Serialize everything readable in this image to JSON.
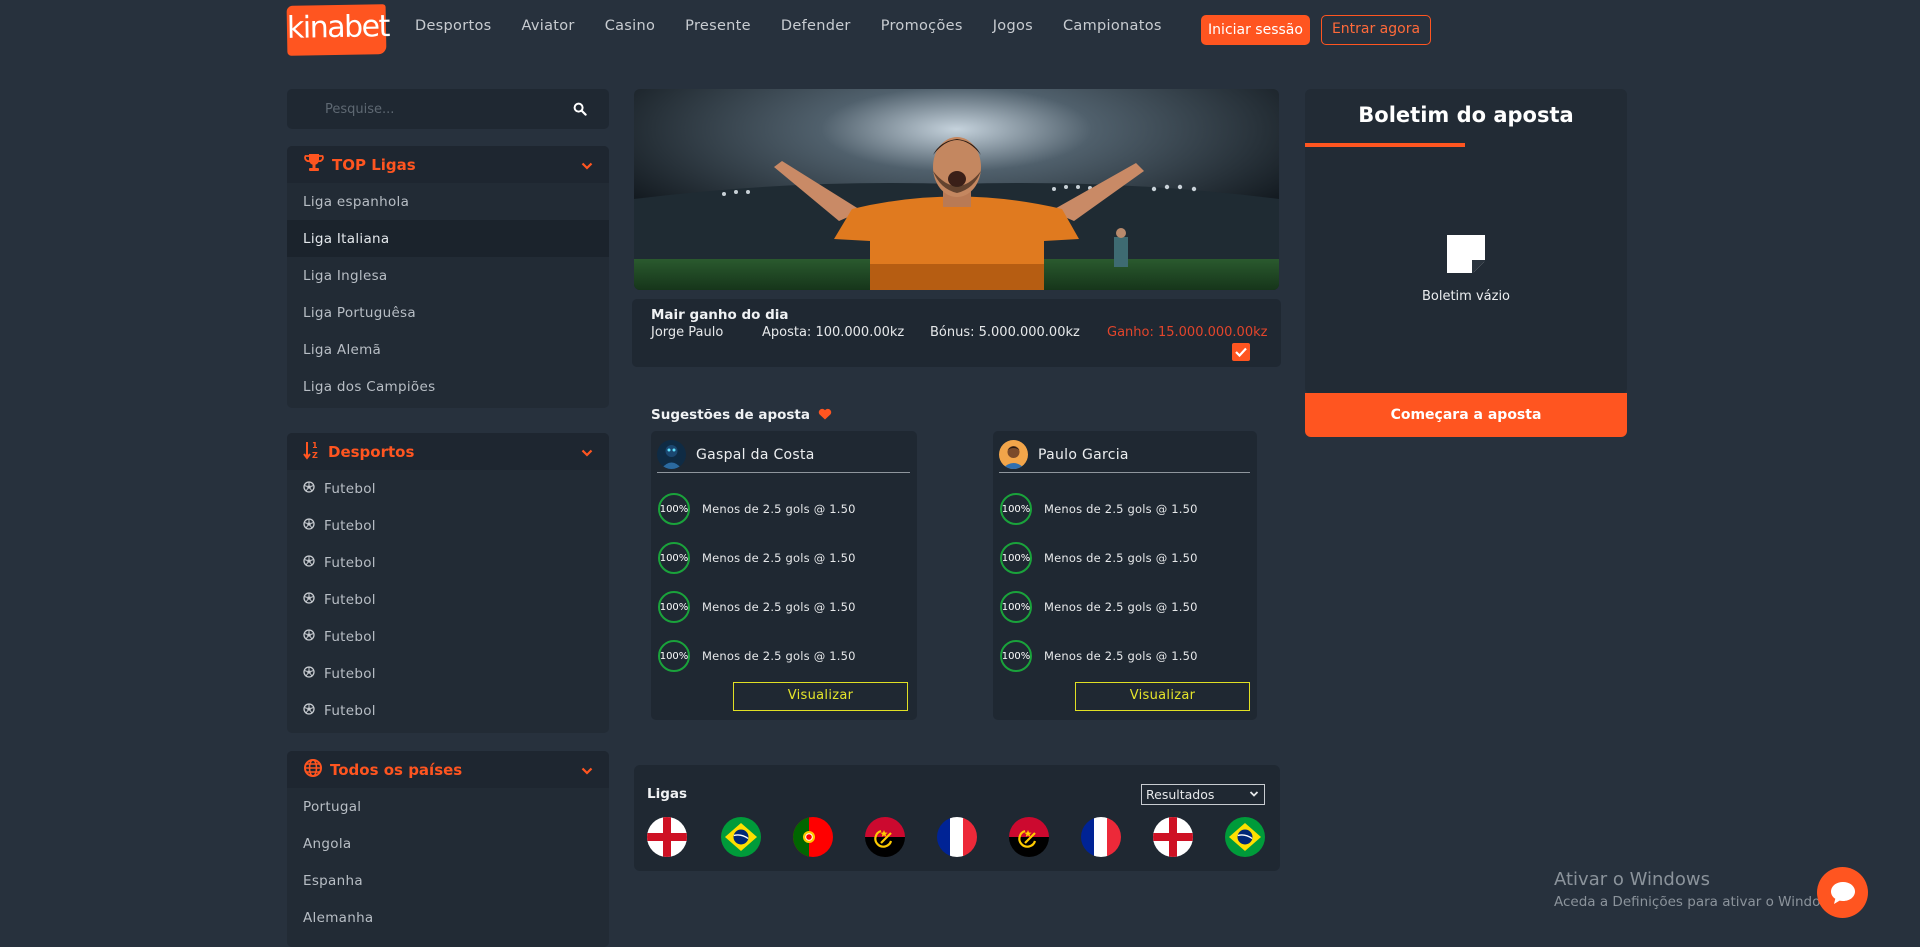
{
  "header": {
    "logo_text": "kinabet",
    "nav": [
      "Desportos",
      "Aviator",
      "Casino",
      "Presente",
      "Defender",
      "Promoções",
      "Jogos",
      "Campionatos"
    ],
    "login_label": "Iniciar sessão",
    "join_label": "Entrar agora"
  },
  "search": {
    "placeholder": "Pesquise..."
  },
  "top_leagues": {
    "title": "TOP Ligas",
    "items": [
      "Liga espanhola",
      "Liga Italiana",
      "Liga Inglesa",
      "Liga Portuguêsa",
      "Liga Alemã",
      "Liga dos Campiões"
    ]
  },
  "sports": {
    "title": "Desportos",
    "items": [
      "Futebol",
      "Futebol",
      "Futebol",
      "Futebol",
      "Futebol",
      "Futebol",
      "Futebol"
    ]
  },
  "countries": {
    "title": "Todos os países",
    "items": [
      "Portugal",
      "Angola",
      "Espanha",
      "Alemanha"
    ]
  },
  "biggest_win": {
    "title": "Mair ganho do dia",
    "name": "Jorge Paulo",
    "stake": "Aposta: 100.000.00kz",
    "bonus": "Bónus: 5.000.000.00kz",
    "gain": "Ganho: 15.000.000.00kz"
  },
  "suggestions": {
    "title": "Sugestões de aposta",
    "cards": [
      {
        "tipster": "Gaspal da Costa",
        "tips": [
          {
            "pct": "100%",
            "text": "Menos de 2.5 gols @ 1.50"
          },
          {
            "pct": "100%",
            "text": "Menos de 2.5 gols @ 1.50"
          },
          {
            "pct": "100%",
            "text": "Menos de 2.5 gols @ 1.50"
          },
          {
            "pct": "100%",
            "text": "Menos de 2.5 gols @ 1.50"
          }
        ],
        "button": "Visualizar"
      },
      {
        "tipster": "Paulo Garcia",
        "tips": [
          {
            "pct": "100%",
            "text": "Menos de 2.5 gols @ 1.50"
          },
          {
            "pct": "100%",
            "text": "Menos de 2.5 gols @ 1.50"
          },
          {
            "pct": "100%",
            "text": "Menos de 2.5 gols @ 1.50"
          },
          {
            "pct": "100%",
            "text": "Menos de 2.5 gols @ 1.50"
          }
        ],
        "button": "Visualizar"
      }
    ]
  },
  "leagues": {
    "title": "Ligas",
    "select_value": "Resultados",
    "flags": [
      "england-flag",
      "brazil-flag",
      "portugal-flag",
      "angola-flag",
      "france-flag",
      "angola-flag",
      "france-flag",
      "england-flag",
      "brazil-flag"
    ]
  },
  "bet_slip": {
    "title": "Boletim do aposta",
    "empty_text": "Boletim vázio",
    "button": "Começara a aposta"
  },
  "watermark": {
    "line1": "Ativar o Windows",
    "line2": "Aceda a Definições para ativar o Windows."
  },
  "colors": {
    "accent": "#ff5520",
    "background": "#27313d",
    "panel": "#222b35",
    "success": "#1aa33b",
    "highlight": "#e5e52a"
  }
}
